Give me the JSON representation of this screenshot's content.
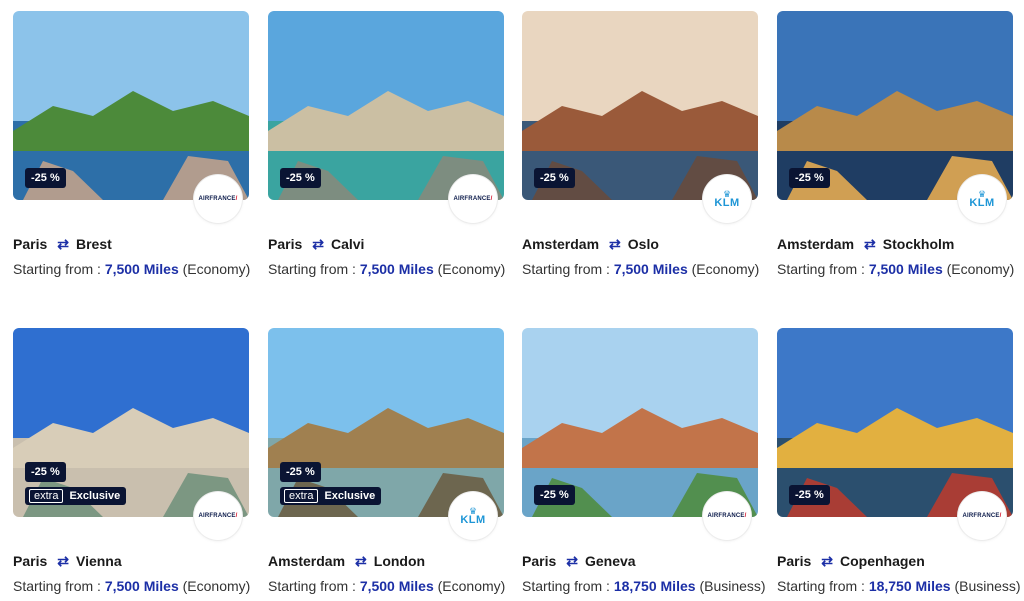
{
  "cards": [
    {
      "from": "Paris",
      "to": "Brest",
      "discount": "-25 %",
      "exclusive": false,
      "airline": "AIRFRANCE",
      "cabin": "(Economy)",
      "miles": "7,500 Miles",
      "prefix": "Starting from :",
      "colors": {
        "sky": "#8cc3ea",
        "sea": "#2d6fa8",
        "land": "#4c8a3a",
        "rock": "#c9a48a"
      }
    },
    {
      "from": "Paris",
      "to": "Calvi",
      "discount": "-25 %",
      "exclusive": false,
      "airline": "AIRFRANCE",
      "cabin": "(Economy)",
      "miles": "7,500 Miles",
      "prefix": "Starting from :",
      "colors": {
        "sky": "#5aa6dd",
        "sea": "#3aa4a0",
        "land": "#cbbfa3",
        "rock": "#8a8a7a"
      }
    },
    {
      "from": "Amsterdam",
      "to": "Oslo",
      "discount": "-25 %",
      "exclusive": false,
      "airline": "KLM",
      "cabin": "(Economy)",
      "miles": "7,500 Miles",
      "prefix": "Starting from :",
      "colors": {
        "sky": "#e9d6c0",
        "sea": "#3a5878",
        "land": "#9a5a3a",
        "rock": "#6a4a3a"
      }
    },
    {
      "from": "Amsterdam",
      "to": "Stockholm",
      "discount": "-25 %",
      "exclusive": false,
      "airline": "KLM",
      "cabin": "(Economy)",
      "miles": "7,500 Miles",
      "prefix": "Starting from :",
      "colors": {
        "sky": "#3a74b8",
        "sea": "#1f3d63",
        "land": "#b88a4a",
        "rock": "#f0b050"
      }
    },
    {
      "from": "Paris",
      "to": "Vienna",
      "discount": "-25 %",
      "exclusive": true,
      "exclusive_extra": "extra",
      "exclusive_label": "Exclusive",
      "airline": "AIRFRANCE",
      "cabin": "(Economy)",
      "miles": "7,500 Miles",
      "prefix": "Starting from :",
      "colors": {
        "sky": "#2f6fd0",
        "sea": "#c9bfae",
        "land": "#d8cdb8",
        "rock": "#6e8f7a"
      }
    },
    {
      "from": "Amsterdam",
      "to": "London",
      "discount": "-25 %",
      "exclusive": true,
      "exclusive_extra": "extra",
      "exclusive_label": "Exclusive",
      "airline": "KLM",
      "cabin": "(Economy)",
      "miles": "7,500 Miles",
      "prefix": "Starting from :",
      "colors": {
        "sky": "#7cc0ec",
        "sea": "#7fa7a9",
        "land": "#a08050",
        "rock": "#6a5a40"
      }
    },
    {
      "from": "Paris",
      "to": "Geneva",
      "discount": "-25 %",
      "exclusive": false,
      "airline": "AIRFRANCE",
      "cabin": "(Business)",
      "miles": "18,750 Miles",
      "prefix": "Starting from :",
      "colors": {
        "sky": "#a9d2ef",
        "sea": "#6aa4c8",
        "land": "#c2744a",
        "rock": "#4e8c3a"
      }
    },
    {
      "from": "Paris",
      "to": "Copenhagen",
      "discount": "-25 %",
      "exclusive": false,
      "airline": "AIRFRANCE",
      "cabin": "(Business)",
      "miles": "18,750 Miles",
      "prefix": "Starting from :",
      "colors": {
        "sky": "#3d78c8",
        "sea": "#2b4f6e",
        "land": "#e2b040",
        "rock": "#c0392b"
      }
    }
  ]
}
